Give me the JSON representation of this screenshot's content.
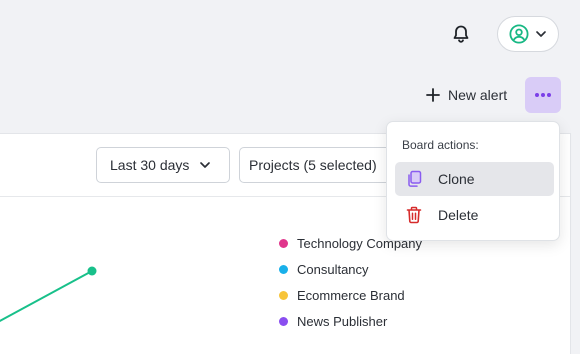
{
  "header": {
    "notifications_icon": "bell-icon",
    "user_icon": "user-circle-icon",
    "new_alert_label": "New alert",
    "more_icon": "more-horizontal-icon"
  },
  "filters": {
    "date_range": "Last 30 days",
    "projects": "Projects (5 selected)"
  },
  "chart_data": {
    "type": "line",
    "legend_position": "right",
    "series": [
      {
        "name": "Technology Company",
        "color": "#e0368c"
      },
      {
        "name": "Consultancy",
        "color": "#19b0ea"
      },
      {
        "name": "Ecommerce Brand",
        "color": "#f7c43a"
      },
      {
        "name": "News Publisher",
        "color": "#8a4ef0"
      }
    ],
    "visible_line": {
      "color": "#18c08a"
    }
  },
  "board_actions": {
    "title": "Board actions:",
    "items": [
      {
        "label": "Clone",
        "icon": "copy-icon",
        "color": "#8a5cf0"
      },
      {
        "label": "Delete",
        "icon": "trash-icon",
        "color": "#d62b2b"
      }
    ]
  }
}
